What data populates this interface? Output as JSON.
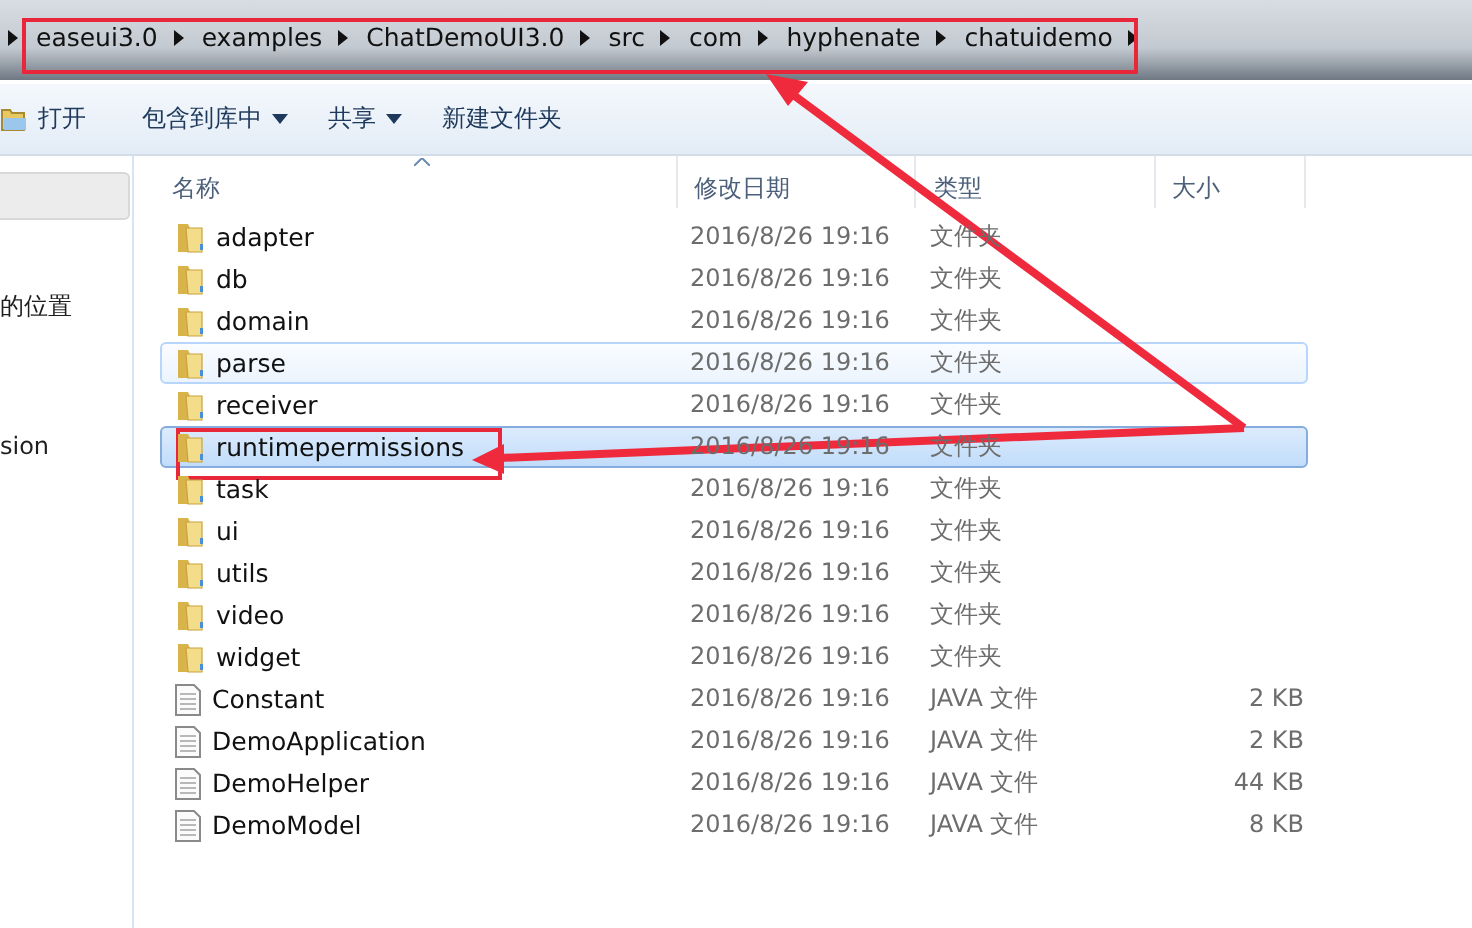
{
  "breadcrumb": {
    "items": [
      "easeui3.0",
      "examples",
      "ChatDemoUI3.0",
      "src",
      "com",
      "hyphenate",
      "chatuidemo"
    ]
  },
  "toolbar": {
    "items": [
      {
        "label": "打开",
        "kind": "open",
        "dropdown": false
      },
      {
        "label": "包含到库中",
        "kind": "plain",
        "dropdown": true
      },
      {
        "label": "共享",
        "kind": "plain",
        "dropdown": true
      },
      {
        "label": "新建文件夹",
        "kind": "plain",
        "dropdown": false
      }
    ]
  },
  "sidebar": {
    "items": [
      {
        "label": "的位置"
      },
      {
        "label": "sion"
      }
    ]
  },
  "table": {
    "columns": [
      {
        "label": "名称",
        "sorted": true
      },
      {
        "label": "修改日期",
        "sorted": false
      },
      {
        "label": "类型",
        "sorted": false
      },
      {
        "label": "大小",
        "sorted": false
      }
    ],
    "rows": [
      {
        "kind": "folder",
        "name": "adapter",
        "date": "2016/8/26 19:16",
        "type": "文件夹",
        "selected": false,
        "hovered": false
      },
      {
        "kind": "folder",
        "name": "db",
        "date": "2016/8/26 19:16",
        "type": "文件夹",
        "selected": false,
        "hovered": false
      },
      {
        "kind": "folder",
        "name": "domain",
        "date": "2016/8/26 19:16",
        "type": "文件夹",
        "selected": false,
        "hovered": false
      },
      {
        "kind": "folder",
        "name": "parse",
        "date": "2016/8/26 19:16",
        "type": "文件夹",
        "selected": false,
        "hovered": true
      },
      {
        "kind": "folder",
        "name": "receiver",
        "date": "2016/8/26 19:16",
        "type": "文件夹",
        "selected": false,
        "hovered": false
      },
      {
        "kind": "folder",
        "name": "runtimepermissions",
        "date": "2016/8/26 19:16",
        "type": "文件夹",
        "selected": true,
        "hovered": false
      },
      {
        "kind": "folder",
        "name": "task",
        "date": "2016/8/26 19:16",
        "type": "文件夹",
        "selected": false,
        "hovered": false
      },
      {
        "kind": "folder",
        "name": "ui",
        "date": "2016/8/26 19:16",
        "type": "文件夹",
        "selected": false,
        "hovered": false
      },
      {
        "kind": "folder",
        "name": "utils",
        "date": "2016/8/26 19:16",
        "type": "文件夹",
        "selected": false,
        "hovered": false
      },
      {
        "kind": "folder",
        "name": "video",
        "date": "2016/8/26 19:16",
        "type": "文件夹",
        "selected": false,
        "hovered": false
      },
      {
        "kind": "folder",
        "name": "widget",
        "date": "2016/8/26 19:16",
        "type": "文件夹",
        "selected": false,
        "hovered": false
      },
      {
        "kind": "file",
        "name": "Constant",
        "date": "2016/8/26 19:16",
        "type": "JAVA 文件",
        "size": "2 KB",
        "selected": false,
        "hovered": false
      },
      {
        "kind": "file",
        "name": "DemoApplication",
        "date": "2016/8/26 19:16",
        "type": "JAVA 文件",
        "size": "2 KB",
        "selected": false,
        "hovered": false
      },
      {
        "kind": "file",
        "name": "DemoHelper",
        "date": "2016/8/26 19:16",
        "type": "JAVA 文件",
        "size": "44 KB",
        "selected": false,
        "hovered": false
      },
      {
        "kind": "file",
        "name": "DemoModel",
        "date": "2016/8/26 19:16",
        "type": "JAVA 文件",
        "size": "8 KB",
        "selected": false,
        "hovered": false
      }
    ]
  }
}
